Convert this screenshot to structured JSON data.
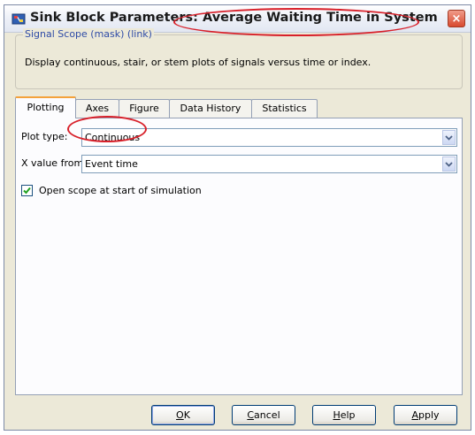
{
  "window": {
    "title_prefix": "Sink Block Parameters:",
    "title_block": "Average Waiting Time in System",
    "close_glyph": "×"
  },
  "mask": {
    "legend": "Signal Scope (mask) (link)",
    "description": "Display continuous, stair, or stem plots of signals versus time or index."
  },
  "tabs": [
    {
      "label": "Plotting",
      "active": true
    },
    {
      "label": "Axes"
    },
    {
      "label": "Figure"
    },
    {
      "label": "Data History"
    },
    {
      "label": "Statistics"
    }
  ],
  "plotting": {
    "plot_type_label": "Plot type:",
    "plot_type_value": "Continuous",
    "x_value_label": "X value from:",
    "x_value_value": "Event time",
    "open_scope_label": "Open scope at start of simulation",
    "open_scope_checked": true
  },
  "buttons": {
    "ok": {
      "mnemonic": "O",
      "rest": "K"
    },
    "cancel": {
      "mnemonic": "C",
      "rest": "ancel"
    },
    "help": {
      "mnemonic": "H",
      "rest": "elp"
    },
    "apply": {
      "mnemonic": "A",
      "rest": "pply"
    }
  },
  "colors": {
    "annotation": "#d8202a",
    "tab_highlight": "#f4a23a",
    "legend_text": "#2e4ba6",
    "close_button": "#d84a30"
  }
}
